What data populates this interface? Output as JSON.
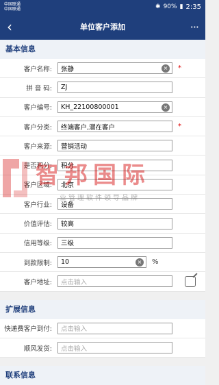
{
  "status_bar": {
    "carrier1": "中国联通",
    "carrier2": "中国联通",
    "battery": "90%",
    "time": "2:35"
  },
  "header": {
    "title": "单位客户添加",
    "more": "···"
  },
  "basic_section": {
    "title": "基本信息",
    "rows": [
      {
        "label": "客户名称:",
        "value": "张静"
      },
      {
        "label": "拼 音 码:",
        "value": "ZJ"
      },
      {
        "label": "客户编号:",
        "value": "KH_22100800001"
      },
      {
        "label": "客户分类:",
        "value": "终端客户,潜在客户"
      },
      {
        "label": "客户来源:",
        "value": "营销活动"
      },
      {
        "label": "是否积分:",
        "value": "积分"
      },
      {
        "label": "客户区域:",
        "value": "北京"
      },
      {
        "label": "客户行业:",
        "value": "设备"
      },
      {
        "label": "价值评估:",
        "value": "较高"
      },
      {
        "label": "信用等级:",
        "value": "三级"
      },
      {
        "label": "到款限制:",
        "value": "10"
      },
      {
        "label": "客户地址:",
        "placeholder": "点击输入"
      }
    ],
    "required_mark": "*",
    "percent_unit": "%"
  },
  "extended_section": {
    "title": "扩展信息",
    "rows": [
      {
        "label": "快递费客户到付:",
        "placeholder": "点击输入"
      },
      {
        "label": "顺风发货:",
        "placeholder": "点击输入"
      }
    ]
  },
  "contact_section": {
    "title": "联系信息"
  },
  "watermark": {
    "main": "智邦国际",
    "sub": "业管理软件领导品牌"
  }
}
